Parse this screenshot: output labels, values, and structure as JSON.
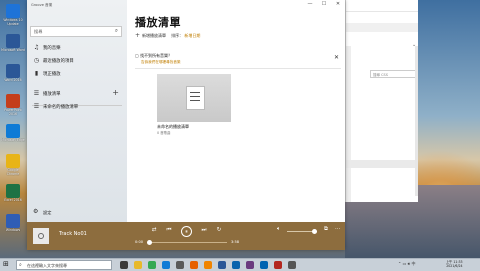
{
  "desktop": {
    "icons": [
      {
        "label": "Windows 10 Update",
        "color": "#1e73d8"
      },
      {
        "label": "Microsoft Word",
        "color": "#2b5797"
      },
      {
        "label": "Word 2016",
        "color": "#2b5797"
      },
      {
        "label": "PowerPoint 2016",
        "color": "#c43e1c"
      },
      {
        "label": "Microsoft Edge",
        "color": "#0f7bd6"
      },
      {
        "label": "Google Chrome",
        "color": "#e8b417"
      },
      {
        "label": "Excel 2016",
        "color": "#1f7244"
      },
      {
        "label": "Windows",
        "color": "#2f5db5"
      }
    ]
  },
  "background_window": {
    "search_placeholder": "搜尋 CSS"
  },
  "player": {
    "app_title": "Groove 音樂",
    "search": {
      "placeholder": "搜尋",
      "icon": "search-icon"
    },
    "nav": [
      {
        "label": "我的音樂",
        "icon": "music-note-icon"
      },
      {
        "label": "最近播放的項目",
        "icon": "clock-icon"
      },
      {
        "label": "現正播放",
        "icon": "equalizer-icon"
      },
      {
        "label": "播放清單",
        "icon": "playlist-icon"
      },
      {
        "label": "未命名的播放清單",
        "icon": "playlist-icon"
      }
    ],
    "settings_label": "設定",
    "main": {
      "heading": "播放清單",
      "new_playlist": "新增播放清單",
      "sort_label": "排序：",
      "sort_value": "新增日期",
      "notice_title": "找不到所有音樂？",
      "notice_link": "告訴我們在哪裡尋找音樂",
      "tile_name": "未命名的播放清單",
      "tile_sub": "0 首歌曲"
    },
    "window_controls": [
      "—",
      "☐",
      "✕"
    ],
    "now_playing": {
      "track": "Track No01",
      "time_elapsed": "0:00",
      "time_total": "3:58",
      "progress": 0.02,
      "volume": 0.9
    }
  },
  "taskbar": {
    "search_placeholder": "在這裡輸入文字來搜尋",
    "time": "上午 11:33",
    "date": "2021/6/24",
    "apps": [
      {
        "name": "task-view",
        "color": "#3a3a3a"
      },
      {
        "name": "file-explorer",
        "color": "#e8b92b"
      },
      {
        "name": "chrome",
        "color": "#34a853"
      },
      {
        "name": "edge",
        "color": "#0f7bd6"
      },
      {
        "name": "store",
        "color": "#5a5a5a"
      },
      {
        "name": "firefox",
        "color": "#e66000"
      },
      {
        "name": "vlc",
        "color": "#f08400"
      },
      {
        "name": "word",
        "color": "#2b5797"
      },
      {
        "name": "outlook",
        "color": "#0a64ad"
      },
      {
        "name": "groove",
        "color": "#6b3a7e"
      },
      {
        "name": "photos",
        "color": "#0063b1"
      },
      {
        "name": "media",
        "color": "#b3261e"
      },
      {
        "name": "settings",
        "color": "#555555"
      }
    ]
  }
}
